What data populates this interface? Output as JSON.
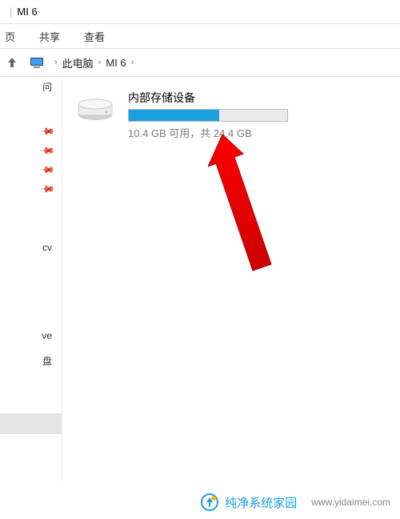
{
  "window": {
    "title": "MI 6",
    "title_sep": "|"
  },
  "ribbon": {
    "tabs": [
      "页",
      "共享",
      "查看"
    ]
  },
  "address": {
    "up_icon": "nav-up-icon",
    "crumbs": [
      "此电脑",
      "MI 6"
    ]
  },
  "sidebar": {
    "label_top": "问",
    "pins": [
      "",
      "",
      "",
      ""
    ],
    "items_lower": [
      "cv",
      "ve",
      "盘"
    ]
  },
  "drive": {
    "title": "内部存储设备",
    "free_text": "10.4 GB 可用，共 24.4 GB",
    "free_gb": 10.4,
    "total_gb": 24.4,
    "used_percent": 57
  },
  "footer": {
    "brand": "纯净系统家园",
    "url": "www.yidaimei.com"
  },
  "colors": {
    "accent": "#1aa0e0",
    "arrow": "#ff0000"
  }
}
